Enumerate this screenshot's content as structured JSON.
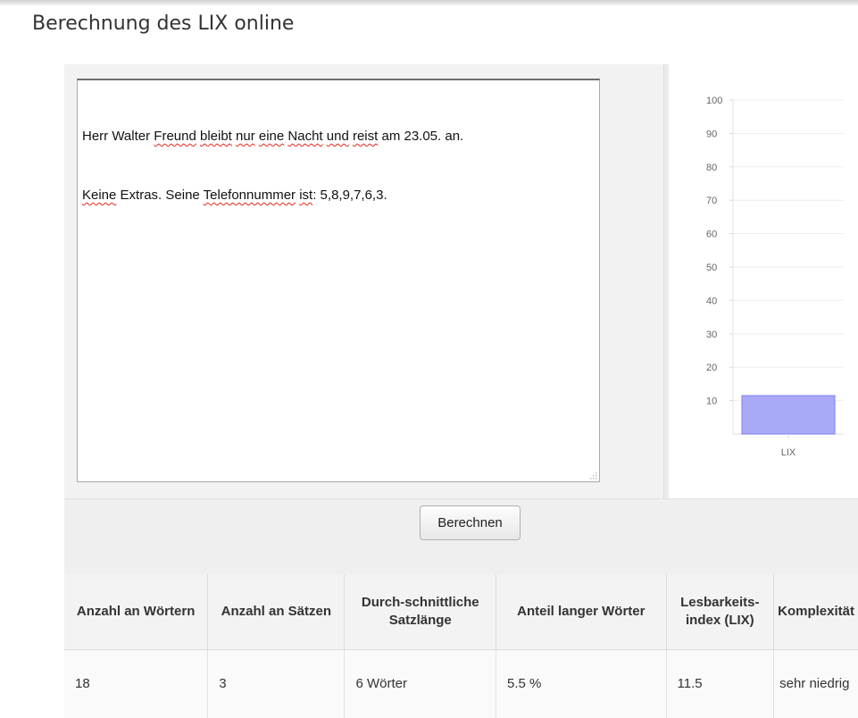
{
  "page": {
    "title": "Berechnung des LIX online"
  },
  "editor": {
    "line1": [
      {
        "t": "Herr Walter ",
        "s": false
      },
      {
        "t": "Freund",
        "s": true
      },
      {
        "t": " ",
        "s": false
      },
      {
        "t": "bleibt",
        "s": true
      },
      {
        "t": " ",
        "s": false
      },
      {
        "t": "nur",
        "s": true
      },
      {
        "t": " ",
        "s": false
      },
      {
        "t": "eine",
        "s": true
      },
      {
        "t": " ",
        "s": false
      },
      {
        "t": "Nacht",
        "s": true
      },
      {
        "t": " ",
        "s": false
      },
      {
        "t": "und",
        "s": true
      },
      {
        "t": " ",
        "s": false
      },
      {
        "t": "reist",
        "s": true
      },
      {
        "t": " am 23.05. an.",
        "s": false
      }
    ],
    "line2": [
      {
        "t": "Keine",
        "s": true
      },
      {
        "t": " Extras. Seine ",
        "s": false
      },
      {
        "t": "Telefonnummer",
        "s": true
      },
      {
        "t": " ",
        "s": false
      },
      {
        "t": "ist",
        "s": true
      },
      {
        "t": ": 5,8,9,7,6,3.",
        "s": false
      }
    ]
  },
  "actions": {
    "calculate_label": "Berechnen"
  },
  "chart_data": {
    "type": "bar",
    "categories": [
      "LIX"
    ],
    "values": [
      11.5
    ],
    "ylim": [
      0,
      100
    ],
    "yticks": [
      10,
      20,
      30,
      40,
      50,
      60,
      70,
      80,
      90,
      100
    ],
    "grid": true,
    "bar_color": "#a9aaf7",
    "bar_border": "#7d7ef0"
  },
  "results": {
    "headers": [
      "Anzahl an Wörtern",
      "Anzahl an Sätzen",
      "Durch-schnittliche Satzlänge",
      "Anteil langer Wörter",
      "Lesbarkeits-index (LIX)",
      "Komplexität"
    ],
    "values": [
      "18",
      "3",
      "6 Wörter",
      "5.5 %",
      "11.5",
      "sehr niedrig"
    ]
  }
}
